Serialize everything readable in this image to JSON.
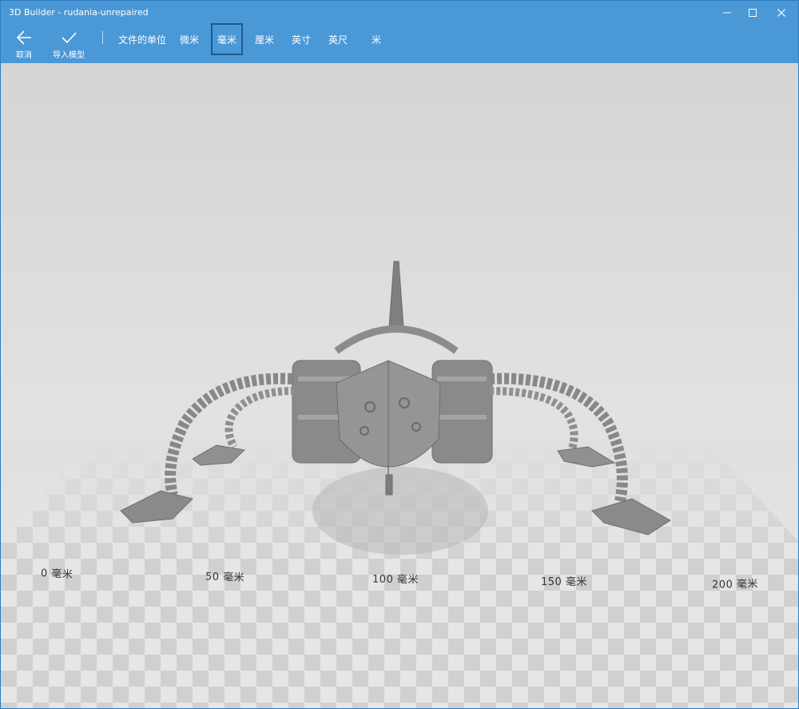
{
  "window": {
    "title": "3D Builder - rudania-unrepaired"
  },
  "toolbar": {
    "cancel_label": "取消",
    "import_label": "导入模型",
    "units_label": "文件的单位",
    "units": [
      {
        "label": "微米",
        "selected": false
      },
      {
        "label": "毫米",
        "selected": true
      },
      {
        "label": "厘米",
        "selected": false
      },
      {
        "label": "英寸",
        "selected": false
      },
      {
        "label": "英尺",
        "selected": false
      },
      {
        "label": "米",
        "selected": false
      }
    ]
  },
  "ruler": {
    "ticks": [
      "0 毫米",
      "50 毫米",
      "100 毫米",
      "150 毫米",
      "200 毫米"
    ]
  },
  "colors": {
    "titlebar": "#4b98d6",
    "selected_border": "#1c5a8b",
    "model": "#8c8c8c"
  },
  "icons": {
    "cancel": "arrow-left-icon",
    "import": "checkmark-icon",
    "minimize": "minimize-icon",
    "maximize": "maximize-icon",
    "close": "close-icon"
  }
}
